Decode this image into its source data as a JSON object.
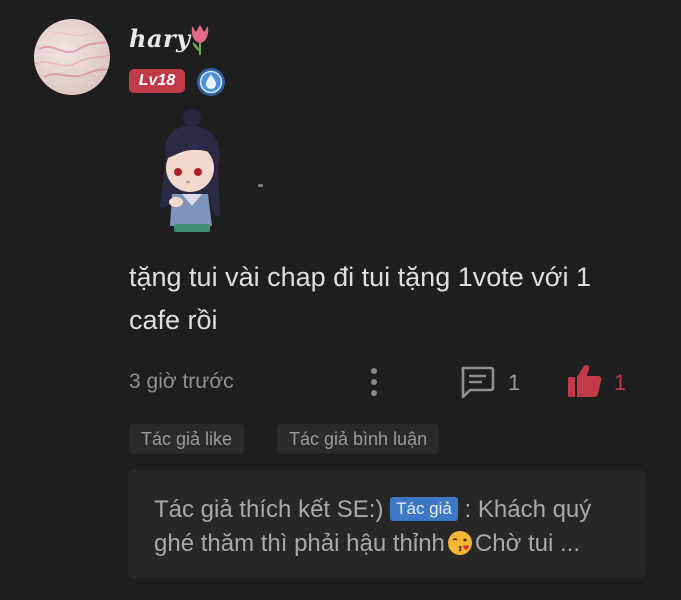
{
  "user": {
    "name": "hary",
    "level": "Lv18",
    "avatar_icon": "pink-marble-avatar",
    "name_emoji": "tulip-icon",
    "rank_icon": "water-drop-rank-icon"
  },
  "comment": {
    "sticker": "chibi-girl-sticker",
    "text": "tặng tui vài chap đi tui tặng 1vote với 1 cafe rồi",
    "time": "3 giờ trước",
    "reply_count": "1",
    "like_count": "1"
  },
  "tags": [
    "Tác giả like",
    "Tác giả bình luận"
  ],
  "reply": {
    "prefix": "Tác giả thích kết SE:)",
    "badge": "Tác giả",
    "text_before_emoji": ": Khách quý ghé thăm thì phải hậu thỉnh",
    "emoji": "kissing-face-emoji",
    "text_after_emoji": "Chờ tui ..."
  },
  "colors": {
    "background": "#1e1e1e",
    "accent_red": "#c03a4a",
    "badge_blue": "#3e78c4"
  }
}
